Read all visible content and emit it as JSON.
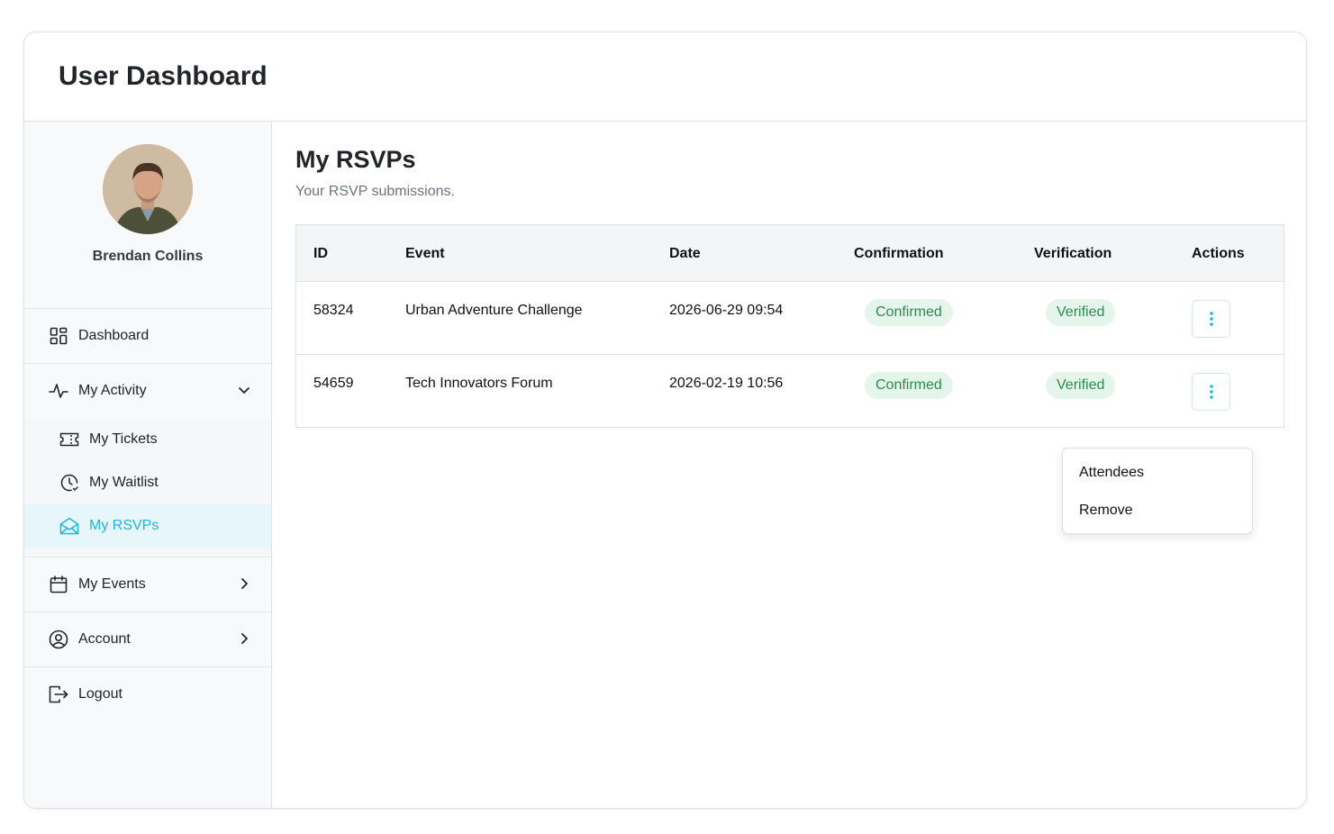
{
  "header": {
    "title": "User Dashboard"
  },
  "profile": {
    "name": "Brendan Collins"
  },
  "nav": {
    "dashboard": "Dashboard",
    "my_activity": "My Activity",
    "sub": {
      "tickets": "My Tickets",
      "waitlist": "My Waitlist",
      "rsvps": "My RSVPs"
    },
    "my_events": "My Events",
    "account": "Account",
    "logout": "Logout"
  },
  "main": {
    "title": "My RSVPs",
    "subtitle": "Your RSVP submissions.",
    "columns": [
      "ID",
      "Event",
      "Date",
      "Confirmation",
      "Verification",
      "Actions"
    ],
    "rows": [
      {
        "id": "58324",
        "event": "Urban Adventure Challenge",
        "date": "2026-06-29 09:54",
        "confirmation": "Confirmed",
        "verification": "Verified"
      },
      {
        "id": "54659",
        "event": "Tech Innovators Forum",
        "date": "2026-02-19 10:56",
        "confirmation": "Confirmed",
        "verification": "Verified"
      }
    ]
  },
  "dropdown": {
    "items": [
      "Attendees",
      "Remove"
    ]
  },
  "colors": {
    "accent": "#1fb6d8",
    "badge_bg": "#e5f5ec",
    "badge_text": "#2c8a4e"
  },
  "icons": [
    "dashboard-icon",
    "activity-icon",
    "ticket-icon",
    "waitlist-clock-icon",
    "envelope-open-icon",
    "calendar-icon",
    "user-circle-icon",
    "logout-icon",
    "chevron-down-icon",
    "chevron-right-icon",
    "kebab-menu-icon"
  ]
}
